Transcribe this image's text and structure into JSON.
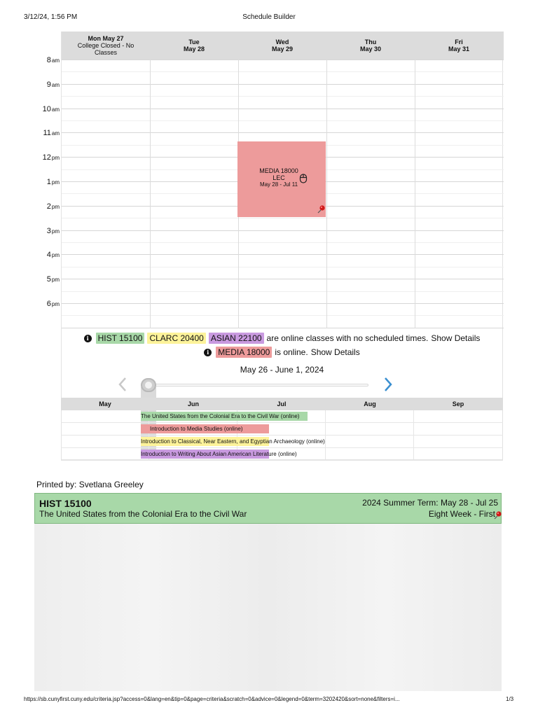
{
  "print_header": {
    "date": "3/12/24, 1:56 PM",
    "title": "Schedule Builder"
  },
  "calendar": {
    "days": [
      {
        "label": "Mon May 27",
        "note": "College Closed - No Classes"
      },
      {
        "label": "Tue",
        "date": "May 28"
      },
      {
        "label": "Wed",
        "date": "May 29"
      },
      {
        "label": "Thu",
        "date": "May 30"
      },
      {
        "label": "Fri",
        "date": "May 31"
      }
    ],
    "hours": [
      {
        "num": "8",
        "ap": "am"
      },
      {
        "num": "9",
        "ap": "am"
      },
      {
        "num": "10",
        "ap": "am"
      },
      {
        "num": "11",
        "ap": "am"
      },
      {
        "num": "12",
        "ap": "pm"
      },
      {
        "num": "1",
        "ap": "pm"
      },
      {
        "num": "2",
        "ap": "pm"
      },
      {
        "num": "3",
        "ap": "pm"
      },
      {
        "num": "4",
        "ap": "pm"
      },
      {
        "num": "5",
        "ap": "pm"
      },
      {
        "num": "6",
        "ap": "pm"
      }
    ],
    "event": {
      "course": "MEDIA 18000",
      "type": "LEC",
      "dates": "May 28 - Jul 11",
      "color": "#ed9b9b"
    }
  },
  "online_notice": {
    "tags": [
      "HIST 15100",
      "CLARC 20400",
      "ASIAN 22100"
    ],
    "text": "are online classes with no scheduled times.",
    "details_link": "Show Details",
    "online_tag": "MEDIA 18000",
    "online_text": "is online.",
    "online_details_link": "Show Details"
  },
  "date_range": "May 26 - June 1, 2024",
  "timeline": {
    "months": [
      "May",
      "Jun",
      "Jul",
      "Aug",
      "Sep"
    ],
    "rows": [
      {
        "label": "The United States from the Colonial Era to the Civil War (online)",
        "color": "#a8d8a8"
      },
      {
        "label": "Introduction to Media Studies (online)",
        "color": "#ed9b9b"
      },
      {
        "label": "Introduction to Classical, Near Eastern, and Egyptian Archaeology (online)",
        "color": "#fdf39a"
      },
      {
        "label": "Introduction to Writing About Asian American Literature (online)",
        "color": "#c99ae0"
      }
    ]
  },
  "printed_by": "Printed by: Svetlana Greeley",
  "course_card": {
    "code": "HIST 15100",
    "title": "The United States from the Colonial Era to the Civil War",
    "term": "2024 Summer Term: May 28 - Jul 25",
    "session": "Eight Week - First",
    "color": "#a8d8a8"
  },
  "footer": {
    "url": "https://sb.cunyfirst.cuny.edu/criteria.jsp?access=0&lang=en&tip=0&page=criteria&scratch=0&advice=0&legend=0&term=3202420&sort=none&filters=i...",
    "page": "1/3"
  },
  "icons": {
    "info": "info-circle-icon",
    "mouse": "mouse-icon",
    "pin": "pushpin-icon",
    "prev": "chevron-left-icon",
    "next": "chevron-right-icon"
  }
}
